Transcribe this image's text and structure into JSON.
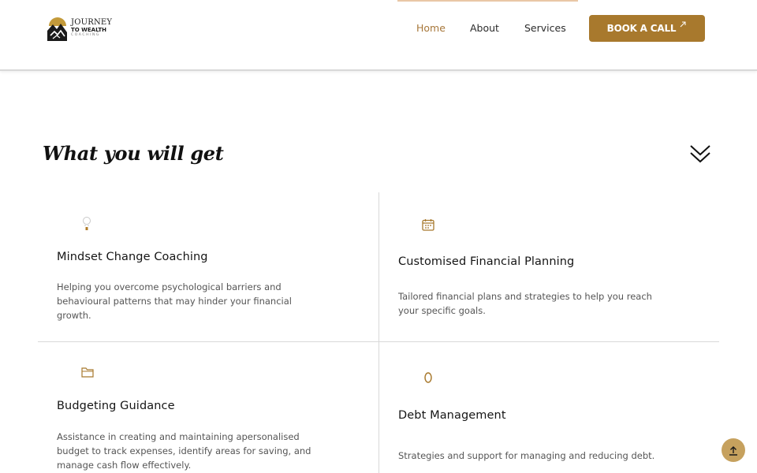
{
  "header": {
    "logo": {
      "line1": "JOURNEY",
      "line2": "TO WEALTH",
      "line3": "COACHING"
    },
    "nav": [
      {
        "label": "Home",
        "active": true
      },
      {
        "label": "About",
        "active": false
      },
      {
        "label": "Services",
        "active": false
      }
    ],
    "cta_label": "BOOK A CALL",
    "cta_icon": "arrow-up-right-icon"
  },
  "section": {
    "title": "What you will get",
    "toggle_icon": "double-chevron-down-icon"
  },
  "cards": [
    {
      "icon": "lightbulb-icon",
      "title": "Mindset Change Coaching",
      "description": "Helping you overcome psychological barriers and behavioural patterns that may hinder your financial growth."
    },
    {
      "icon": "calendar-icon",
      "title": "Customised Financial Planning",
      "description": "Tailored financial plans and strategies to help you reach your specific goals."
    },
    {
      "icon": "folder-icon",
      "title": "Budgeting Guidance",
      "description": "Assistance in creating and maintaining apersonalised budget to track expenses, identify areas for saving, and manage cash flow effectively."
    },
    {
      "icon": "ring-icon",
      "title": "Debt Management",
      "description": "Strategies and support for managing and reducing debt."
    }
  ],
  "scroll_top_icon": "arrow-up-icon",
  "colors": {
    "accent": "#a8792d",
    "accent_light": "#c6a15e",
    "nav_active": "#a7773a",
    "divider": "#d9d9d9"
  }
}
